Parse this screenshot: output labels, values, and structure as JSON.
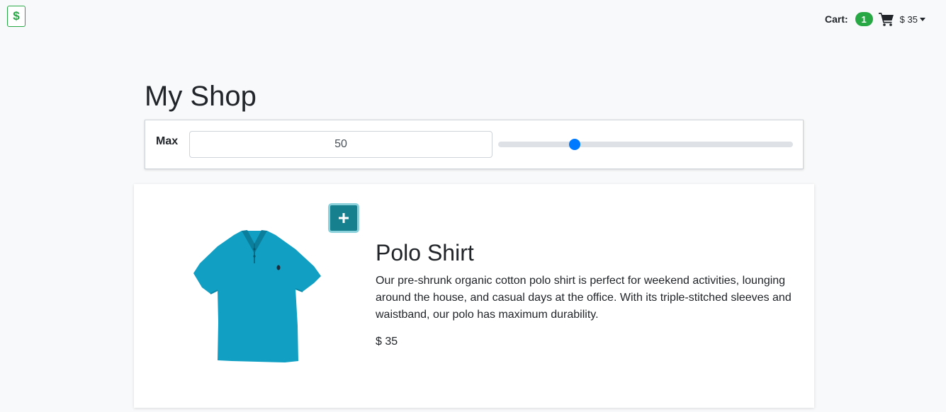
{
  "header": {
    "logo_icon": "dollar-icon",
    "logo_symbol": "$",
    "cart_label": "Cart:",
    "cart_count": "1",
    "cart_icon": "shopping-cart-icon",
    "cart_total": "$ 35"
  },
  "page": {
    "title": "My Shop"
  },
  "filter": {
    "label": "Max",
    "value": "50",
    "slider_fraction": 0.26
  },
  "products": [
    {
      "name": "Polo Shirt",
      "description": "Our pre-shrunk organic cotton polo shirt is perfect for weekend activities, lounging around the house, and casual days at the office. With its triple-stitched sleeves and waistband, our polo has maximum durability.",
      "price": "$ 35",
      "color": "#11a0c4",
      "add_icon": "plus-icon"
    }
  ],
  "colors": {
    "accent_green": "#28a745",
    "primary_blue": "#007bff",
    "add_button_teal": "#17808f"
  }
}
